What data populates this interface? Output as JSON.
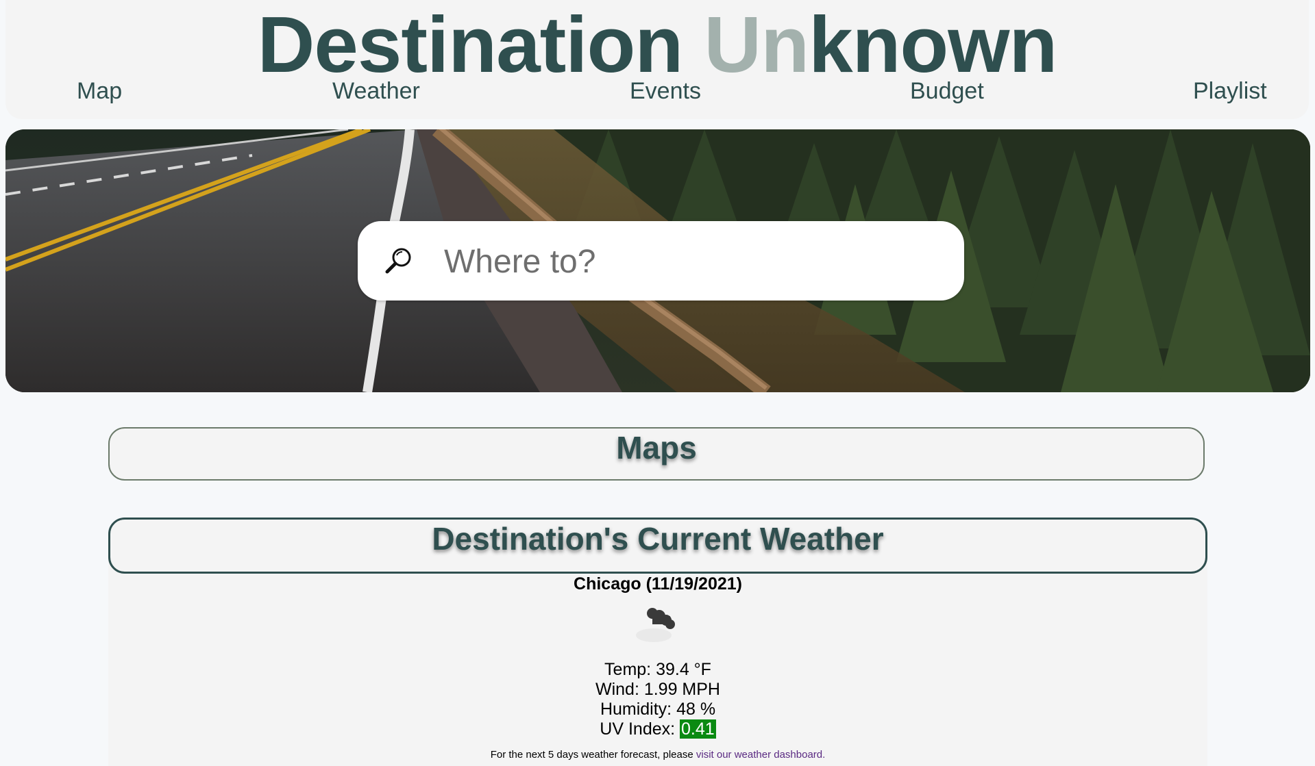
{
  "header": {
    "title_part1": "Destination ",
    "title_accent": "Un",
    "title_part2": "known",
    "nav": {
      "map": "Map",
      "weather": "Weather",
      "events": "Events",
      "budget": "Budget",
      "playlist": "Playlist"
    }
  },
  "search": {
    "placeholder": "Where to?",
    "value": "",
    "icon": "magnifying-glass-icon"
  },
  "sections": {
    "maps_title": "Maps",
    "weather_title": "Destination's Current Weather"
  },
  "weather": {
    "city_date": "Chicago (11/19/2021)",
    "icon": "cloud-icon",
    "temp": "Temp: 39.4 °F",
    "wind": "Wind: 1.99 MPH",
    "humidity": "Humidity: 48 %",
    "uv_label": "UV Index: ",
    "uv_value": "0.41",
    "forecast_note": "For the next 5 days weather forecast, please ",
    "forecast_link": "visit our weather dashboard."
  },
  "colors": {
    "title": "#2f4f4f",
    "title_accent": "#a3b1ad",
    "uv_low": "#0a8a12",
    "link": "#5a2a82"
  }
}
